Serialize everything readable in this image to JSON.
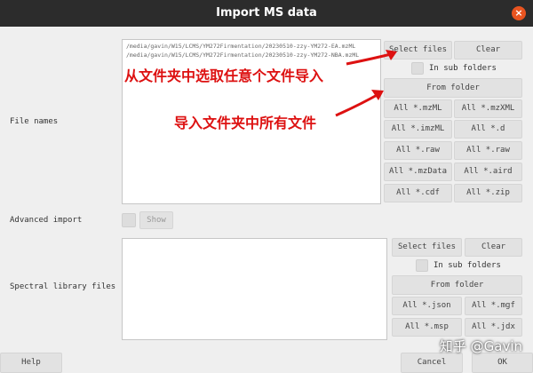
{
  "window": {
    "title": "Import MS data",
    "close_icon": "×"
  },
  "ms_files": {
    "label": "File names",
    "paths": [
      "/media/gavin/W15/LCMS/YM272Firmentation/20230510-zzy-YM272-EA.mzML",
      "/media/gavin/W15/LCMS/YM272Firmentation/20230510-zzy-YM272-NBA.mzML"
    ],
    "select_files": "Select files",
    "clear": "Clear",
    "in_sub_folders": "In sub folders",
    "from_folder": "From folder",
    "all_buttons": [
      "All *.mzML",
      "All *.mzXML",
      "All *.imzML",
      "All *.d",
      "All *.raw",
      "All *.raw",
      "All *.mzData",
      "All *.aird",
      "All *.cdf",
      "All *.zip"
    ]
  },
  "advanced_import": {
    "label": "Advanced import",
    "show": "Show"
  },
  "spectral_library": {
    "label": "Spectral library files",
    "select_files": "Select files",
    "clear": "Clear",
    "in_sub_folders": "In sub folders",
    "from_folder": "From folder",
    "all_buttons": [
      "All *.json",
      "All *.mgf",
      "All *.msp",
      "All *.jdx"
    ]
  },
  "footer": {
    "help": "Help",
    "cancel": "Cancel",
    "ok": "OK"
  },
  "annotations": {
    "select_note": "从文件夹中选取任意个文件导入",
    "folder_note": "导入文件夹中所有文件",
    "color": "#dd1111"
  },
  "watermark": "知乎 @Gavin"
}
